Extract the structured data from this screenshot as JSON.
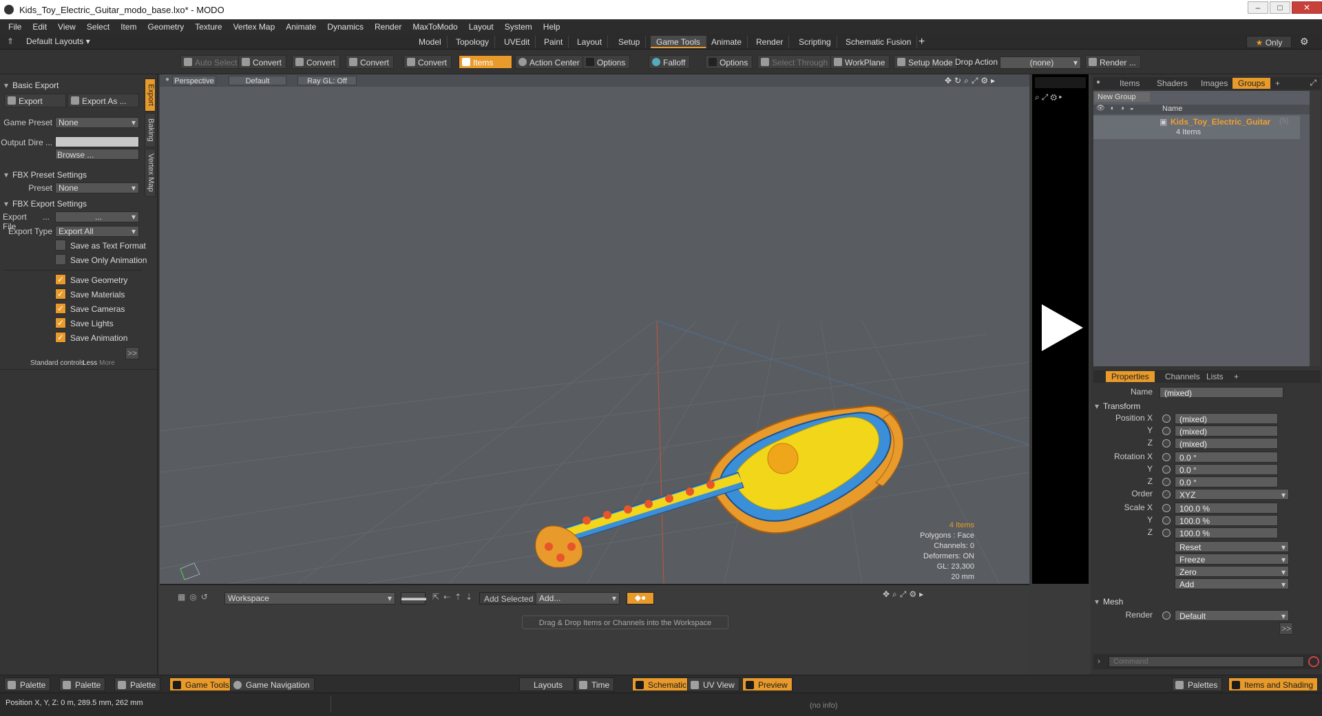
{
  "window": {
    "title": "Kids_Toy_Electric_Guitar_modo_base.lxo* - MODO"
  },
  "menu": [
    "File",
    "Edit",
    "View",
    "Select",
    "Item",
    "Geometry",
    "Texture",
    "Vertex Map",
    "Animate",
    "Dynamics",
    "Render",
    "MaxToModo",
    "Layout",
    "System",
    "Help"
  ],
  "layout_selector": "Default Layouts",
  "tabs": [
    "Model",
    "Topology",
    "UVEdit",
    "Paint",
    "Layout",
    "Setup",
    "Game Tools",
    "Animate",
    "Render",
    "Scripting",
    "Schematic Fusion"
  ],
  "active_tab": "Game Tools",
  "only_label": "Only",
  "toolbar": {
    "auto_select": "Auto Select",
    "convert": "Convert",
    "items": "Items",
    "action_center": "Action Center",
    "options": "Options",
    "falloff": "Falloff",
    "select_through": "Select Through",
    "workplane": "WorkPlane",
    "setup_mode": "Setup Mode",
    "drop_action": "Drop Action",
    "drop_action_value": "(none)",
    "render": "Render ..."
  },
  "left": {
    "basic_export": "Basic Export",
    "export": "Export",
    "export_as": "Export As ...",
    "game_preset_label": "Game Preset",
    "game_preset_value": "None",
    "output_dir_label": "Output Dire ...",
    "browse": "Browse ...",
    "fbx_preset_settings": "FBX Preset Settings",
    "preset_label": "Preset",
    "preset_value": "None",
    "fbx_export_settings": "FBX Export Settings",
    "export_file_label": "Export File",
    "export_file_value": "...",
    "export_type_label": "Export Type",
    "export_type_value": "Export All",
    "checks": [
      {
        "label": "Save as Text Format",
        "checked": false
      },
      {
        "label": "Save Only Animation",
        "checked": false
      },
      {
        "label": "Save Geometry",
        "checked": true
      },
      {
        "label": "Save Materials",
        "checked": true
      },
      {
        "label": "Save Cameras",
        "checked": true
      },
      {
        "label": "Save Lights",
        "checked": true
      },
      {
        "label": "Save Animation",
        "checked": true
      }
    ],
    "more_button": ">>",
    "standard_controls": "Standard controls",
    "less": "Less",
    "more": "More",
    "side_tabs": [
      "Export",
      "Baking",
      "Vertex Map"
    ]
  },
  "viewport": {
    "view": "Perspective",
    "shading": "Default",
    "raygl": "Ray GL: Off",
    "info": {
      "items": "4 Items",
      "polygons": "Polygons : Face",
      "channels": "Channels: 0",
      "deformers": "Deformers: ON",
      "gl": "GL: 23,300",
      "scale": "20 mm"
    }
  },
  "workspace": {
    "workspace_value": "Workspace",
    "add_selected": "Add Selected",
    "add": "Add...",
    "hint": "Drag & Drop Items or Channels into the Workspace"
  },
  "right": {
    "top_tabs": [
      "Items",
      "Shaders",
      "Images",
      "Groups"
    ],
    "active_top_tab": "Groups",
    "new_group": "New Group",
    "col_name": "Name",
    "group_name": "Kids_Toy_Electric_Guitar",
    "group_count": "(5)",
    "group_sub": "4 Items",
    "prop_tabs": [
      "Properties",
      "Channels",
      "Lists"
    ],
    "name_label": "Name",
    "name_value": "(mixed)",
    "transform": "Transform",
    "position_x_label": "Position X",
    "y_label": "Y",
    "z_label": "Z",
    "mixed": "(mixed)",
    "rotation_x_label": "Rotation X",
    "rot_value": "0.0 °",
    "order_label": "Order",
    "order_value": "XYZ",
    "scale_x_label": "Scale X",
    "scale_value": "100.0 %",
    "reset": "Reset",
    "freeze": "Freeze",
    "zero": "Zero",
    "add": "Add",
    "mesh": "Mesh",
    "render_label": "Render",
    "render_value": "Default",
    "more": ">>",
    "command_placeholder": "Command"
  },
  "bottom": {
    "palette": "Palette",
    "game_tools": "Game Tools",
    "game_navigation": "Game Navigation",
    "layouts": "Layouts",
    "time": "Time",
    "schematic": "Schematic",
    "uv_view": "UV View",
    "preview": "Preview",
    "palettes": "Palettes",
    "items_shading": "Items and Shading"
  },
  "status": {
    "position": "Position X, Y, Z:  0 m, 289.5 mm, 262 mm",
    "info": "(no info)"
  }
}
